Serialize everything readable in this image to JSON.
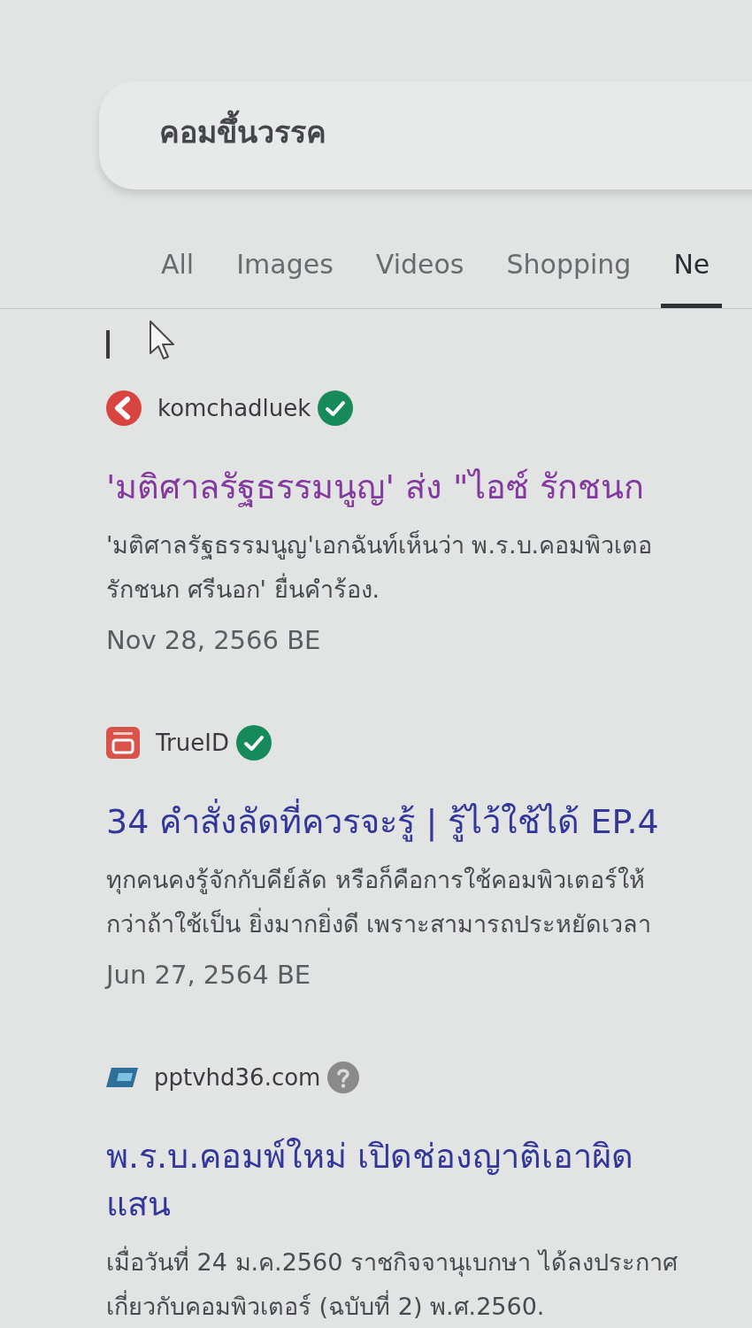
{
  "search": {
    "value": "คอมขึ้นวรรค"
  },
  "tabs": [
    {
      "label": "All",
      "selected": false
    },
    {
      "label": "Images",
      "selected": false
    },
    {
      "label": "Videos",
      "selected": false
    },
    {
      "label": "Shopping",
      "selected": false
    },
    {
      "label": "Ne",
      "selected": true
    }
  ],
  "results": [
    {
      "favicon": {
        "kind": "round"
      },
      "source": "komchadluek",
      "verified": true,
      "visited": true,
      "title_lines": [
        "'มติศาลรัฐธรรมนูญ' ส่ง \"ไอซ์ รักชนก"
      ],
      "snippet_lines": [
        "'มติศาลรัฐธรรมนูญ'เอกฉันท์เห็นว่า พ.ร.บ.คอมพิวเตอ",
        "รักชนก ศรีนอก' ยื่นคำร้อง."
      ],
      "date": "Nov 28, 2566 BE"
    },
    {
      "favicon": {
        "kind": "tile"
      },
      "source": "TrueID",
      "verified": true,
      "visited": false,
      "title_lines": [
        "34 คำสั่งลัดที่ควรจะรู้ | รู้ไว้ใช้ได้ EP.4"
      ],
      "snippet_lines": [
        "ทุกคนคงรู้จักกับคีย์ลัด หรือก็คือการใช้คอมพิวเตอร์ให้",
        "กว่าถ้าใช้เป็น ยิ่งมากยิ่งดี เพราะสามารถประหยัดเวลา"
      ],
      "date": "Jun 27, 2564 BE"
    },
    {
      "favicon": {
        "kind": "slant"
      },
      "source": "pptvhd36.com",
      "verified": false,
      "visited": false,
      "title_lines": [
        "พ.ร.บ.คอมพ์ใหม่ เปิดช่องญาติเอาผิด",
        "แสน"
      ],
      "snippet_lines": [
        "เมื่อวันที่ 24 ม.ค.2560 ราชกิจจานุเบกษา ได้ลงประกาศ",
        "เกี่ยวกับคอมพิวเตอร์ (ฉบับที่ 2) พ.ศ.2560."
      ]
    }
  ]
}
